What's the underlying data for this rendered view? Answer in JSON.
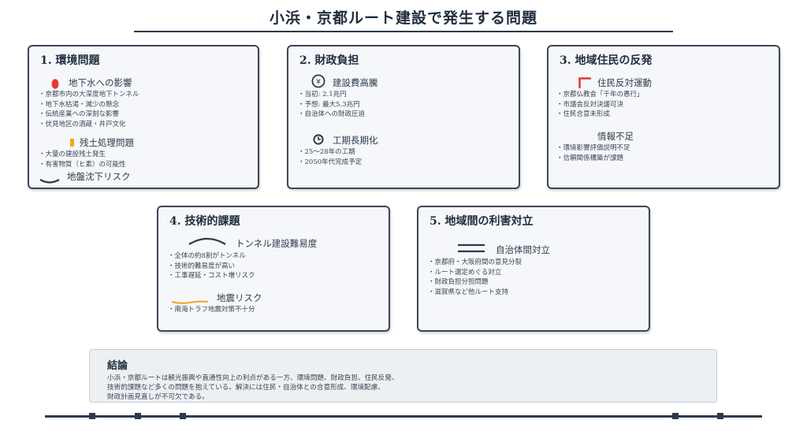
{
  "title": "小浜・京都ルート建設で発生する問題",
  "cards": [
    {
      "title": "1. 環境問題",
      "sections": [
        {
          "label": "地下水への影響",
          "icon": "water-drop-icon",
          "items": [
            "京都市内の大深度地下トンネル",
            "地下水枯渇・減少の懸念",
            "伝統産業への深刻な影響",
            "伏見地区の酒蔵・井戸文化"
          ]
        },
        {
          "label": "残土処理問題",
          "icon": "soil-bar-icon",
          "items": [
            "大量の建設残土発生",
            "有害物質（ヒ素）の可能性"
          ]
        },
        {
          "label": "地盤沈下リスク",
          "icon": "ground-curve-icon",
          "items": []
        }
      ]
    },
    {
      "title": "2. 財政負担",
      "sections": [
        {
          "label": "建設費高騰",
          "icon": "yen-icon",
          "icon_text": "¥",
          "items": [
            "当初: 2.1兆円",
            "予想: 最大5.3兆円",
            "自治体への財政圧迫"
          ]
        },
        {
          "label": "工期長期化",
          "icon": "clock-icon",
          "items": [
            "25～28年の工期",
            "2050年代完成予定"
          ]
        }
      ]
    },
    {
      "title": "3. 地域住民の反発",
      "sections": [
        {
          "label": "住民反対運動",
          "icon": "flag-icon",
          "items": [
            "京都仏教会「千年の愚行」",
            "市議会反対決議可決",
            "住民合意未形成"
          ]
        },
        {
          "label": "情報不足",
          "icon": "",
          "items": [
            "環境影響評価説明不足",
            "信頼関係構築が課題"
          ]
        }
      ]
    },
    {
      "title": "4. 技術的課題",
      "sections": [
        {
          "label": "トンネル建設難易度",
          "icon": "tunnel-arch-icon",
          "items": [
            "全体の約8割がトンネル",
            "技術的難易度が高い",
            "工事遅延・コスト増リスク"
          ]
        },
        {
          "label": "地震リスク",
          "icon": "seismic-wave-icon",
          "items": [
            "南海トラフ地震対策不十分"
          ]
        }
      ]
    },
    {
      "title": "5. 地域間の利害対立",
      "sections": [
        {
          "label": "自治体間対立",
          "icon": "divide-lines-icon",
          "items": [
            "京都府・大阪府間の意見分裂",
            "ルート選定めぐる対立",
            "財政負担分担問題",
            "滋賀県など他ルート支持"
          ]
        }
      ]
    }
  ],
  "conclusion": {
    "title": "結論",
    "lines": [
      "小浜・京都ルートは観光振興や直通性向上の利点がある一方、環境問題、財政負担、住民反発、",
      "技術的課題など多くの問題を抱えている。解決には住民・自治体との合意形成、環境配慮、",
      "財政計画見直しが不可欠である。"
    ]
  },
  "colors": {
    "accent_red": "#e23a2e",
    "accent_orange": "#f2a61f",
    "dark": "#2e3a4b"
  }
}
